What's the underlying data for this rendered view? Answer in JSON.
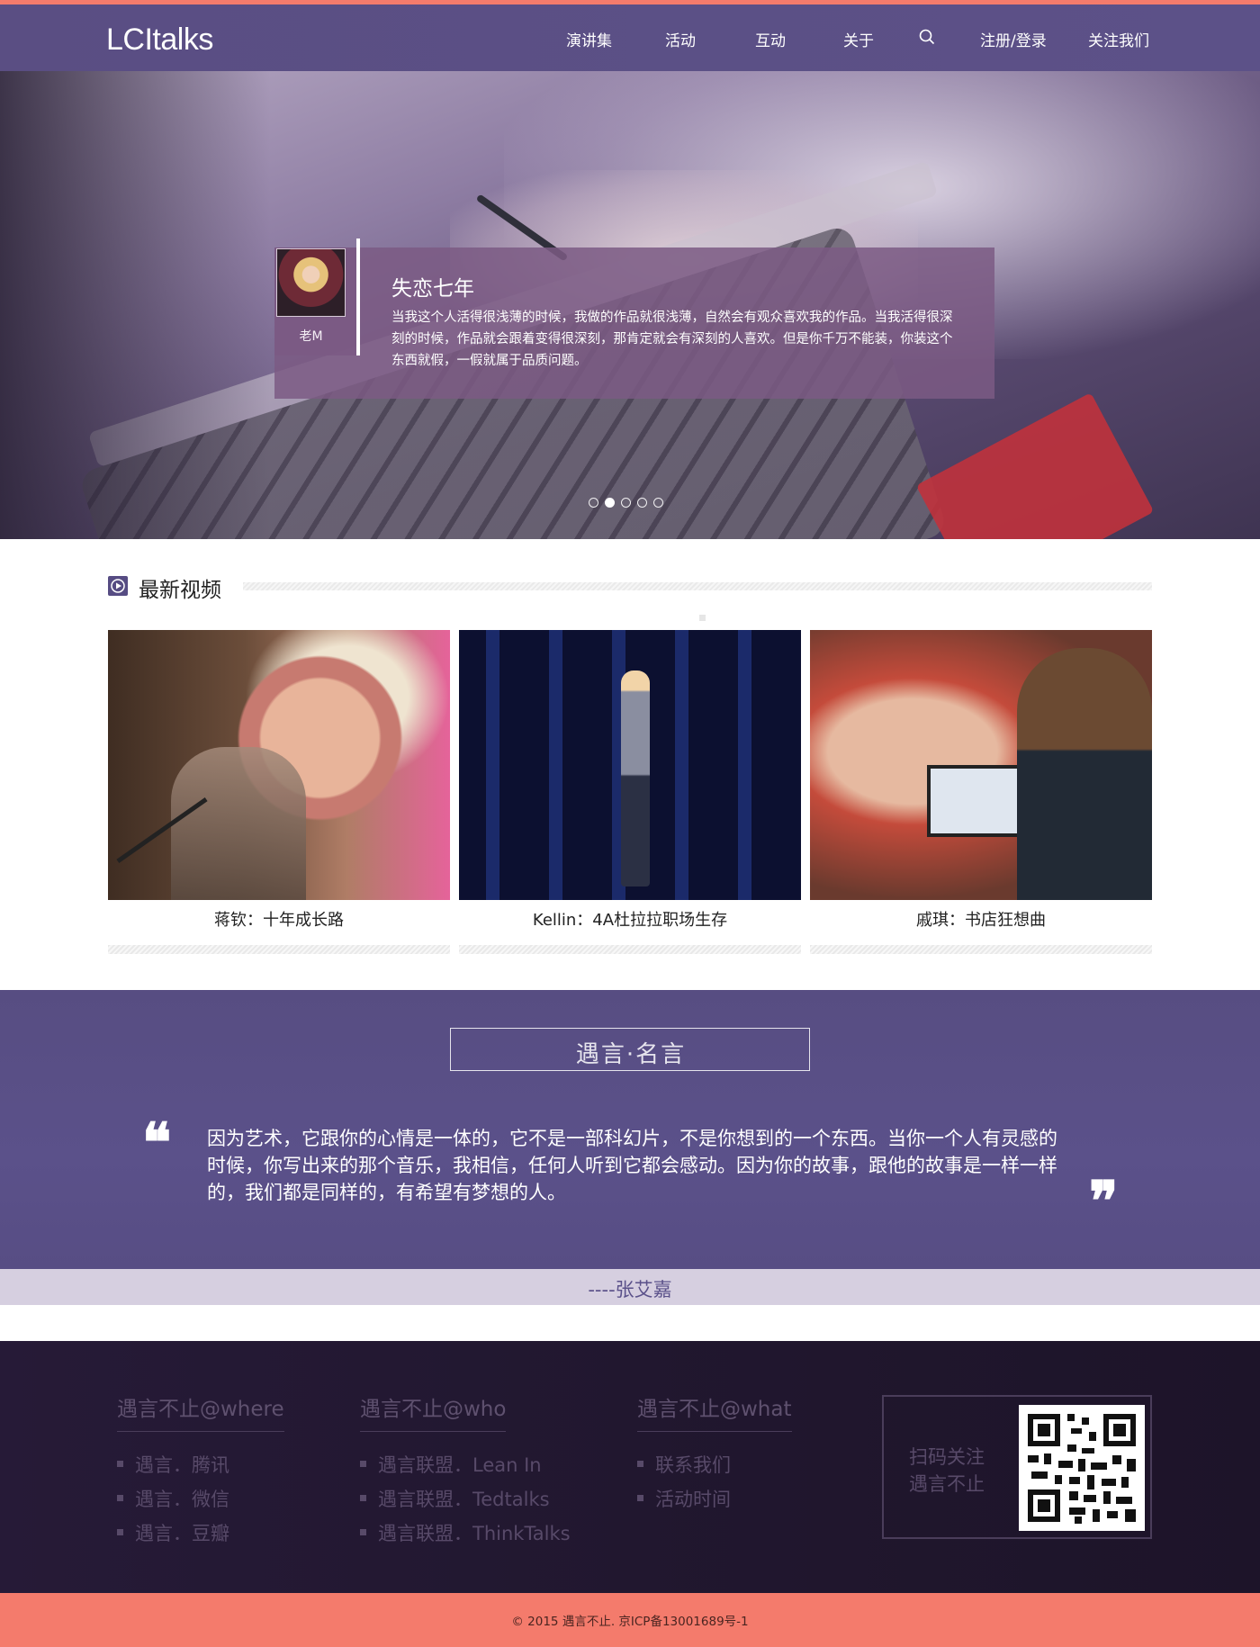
{
  "header": {
    "logo": "LCItalks",
    "nav": [
      {
        "label": "演讲集"
      },
      {
        "label": "活动"
      },
      {
        "label": "互动"
      },
      {
        "label": "关于"
      },
      {
        "label": "注册/登录"
      },
      {
        "label": "关注我们"
      }
    ],
    "search_icon": "search-icon"
  },
  "hero": {
    "speaker_name": "老M",
    "title": "失恋七年",
    "text": "当我这个人活得很浅薄的时候，我做的作品就很浅薄，自然会有观众喜欢我的作品。当我活得很深刻的时候，作品就会跟着变得很深刻，那肯定就会有深刻的人喜欢。但是你千万不能装，你装这个东西就假，一假就属于品质问题。",
    "slides_total": 5,
    "active_slide": 2
  },
  "videos": {
    "title": "最新视频",
    "icon": "play-icon",
    "items": [
      {
        "caption": "蒋钦：十年成长路"
      },
      {
        "caption": "Kellin：4A杜拉拉职场生存"
      },
      {
        "caption": "戚琪：书店狂想曲"
      }
    ]
  },
  "quote": {
    "heading": "遇言·名言",
    "open_mark": "❝",
    "close_mark": "❞",
    "text": "因为艺术，它跟你的心情是一体的，它不是一部科幻片，不是你想到的一个东西。当你一个人有灵感的时候，你写出来的那个音乐，我相信，任何人听到它都会感动。因为你的故事，跟他的故事是一样一样的，我们都是同样的，有希望有梦想的人。",
    "author": "----张艾嘉"
  },
  "footer": {
    "columns": [
      {
        "title": "遇言不止@where",
        "items": [
          "遇言．腾讯",
          "遇言．微信",
          "遇言．豆瓣"
        ]
      },
      {
        "title": "遇言不止@who",
        "items": [
          "遇言联盟．Lean In",
          "遇言联盟．Tedtalks",
          "遇言联盟．ThinkTalks"
        ]
      },
      {
        "title": "遇言不止@what",
        "items": [
          "联系我们",
          "活动时间"
        ]
      }
    ],
    "qr_line1": "扫码关注",
    "qr_line2": "遇言不止",
    "copyright": "© 2015 遇言不止. 京ICP备13001689号-1"
  },
  "colors": {
    "accent": "#f47b6c",
    "header": "#5a4e83",
    "footer": "#21172f",
    "quote_band": "#d6cfe0"
  }
}
